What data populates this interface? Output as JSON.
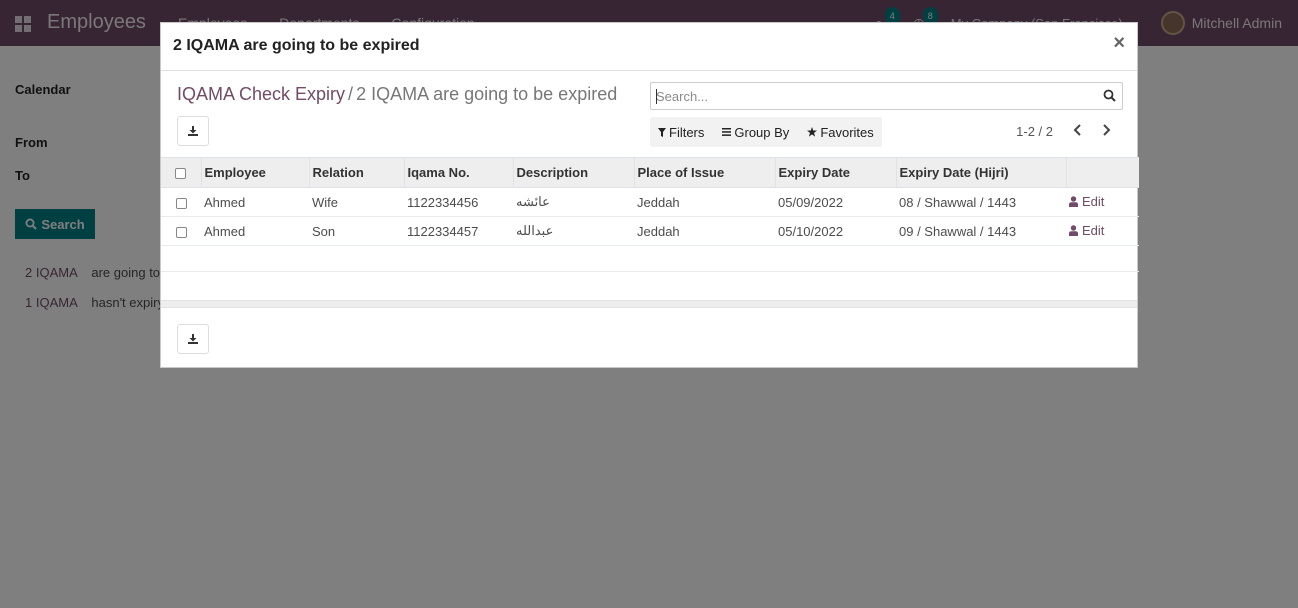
{
  "navbar": {
    "brand": "Employees",
    "menu": [
      "Employees",
      "Departments",
      "Configuration"
    ],
    "chat_badge": "4",
    "activity_badge": "8",
    "company": "My Company (San Francisco)",
    "user": "Mitchell Admin",
    "color": "#714b67"
  },
  "background": {
    "calendar_label": "Calendar",
    "from_label": "From",
    "to_label": "To",
    "search_label": "Search",
    "rows": [
      {
        "link": "2 IQAMA",
        "text": "are going to"
      },
      {
        "link": "1 IQAMA",
        "text": "hasn't expiry"
      }
    ]
  },
  "modal": {
    "title": "2 IQAMA are going to be expired",
    "close": "×",
    "breadcrumb": {
      "parent": "IQAMA Check Expiry",
      "separator": "/",
      "current": "2 IQAMA are going to be expired"
    },
    "search": {
      "placeholder": "Search..."
    },
    "filters_label": "Filters",
    "groupby_label": "Group By",
    "favorites_label": "Favorites",
    "pager": "1-2 / 2",
    "columns": [
      "Employee",
      "Relation",
      "Iqama No.",
      "Description",
      "Place of Issue",
      "Expiry Date",
      "Expiry Date (Hijri)"
    ],
    "rows": [
      {
        "employee": "Ahmed",
        "relation": "Wife",
        "iqama": "1122334456",
        "description": "عائشه",
        "place": "Jeddah",
        "expiry": "05/09/2022",
        "hijri": "08 / Shawwal / 1443",
        "action": "Edit"
      },
      {
        "employee": "Ahmed",
        "relation": "Son",
        "iqama": "1122334457",
        "description": "عبدالله",
        "place": "Jeddah",
        "expiry": "05/10/2022",
        "hijri": "09 / Shawwal / 1443",
        "action": "Edit"
      }
    ]
  },
  "icons": {
    "apps": "apps-grid-icon",
    "download": "download-icon",
    "search": "search-icon",
    "filter": "filter-icon",
    "groupby": "bars-icon",
    "favorites": "star-icon",
    "edit": "user-icon",
    "prev": "chevron-left-icon",
    "next": "chevron-right-icon"
  }
}
